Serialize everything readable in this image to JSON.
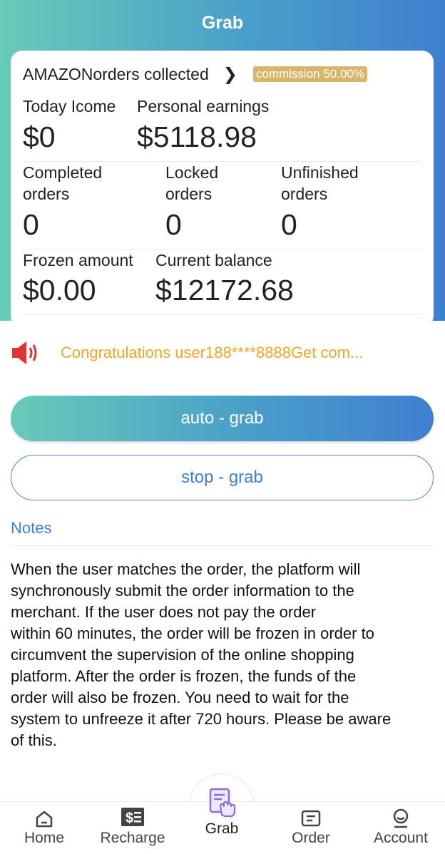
{
  "header": {
    "title": "Grab"
  },
  "card": {
    "title": "AMAZONorders collected",
    "commission_badge": "commission 50.00%",
    "today_income_label": "Today Icome",
    "today_income_value": "$0",
    "personal_earnings_label": "Personal earnings",
    "personal_earnings_value": "$5118.98",
    "completed_orders_label_1": "Completed",
    "completed_orders_label_2": "orders",
    "completed_orders_value": "0",
    "locked_orders_label_1": "Locked",
    "locked_orders_label_2": "orders",
    "locked_orders_value": "0",
    "unfinished_orders_label_1": "Unfinished",
    "unfinished_orders_label_2": "orders",
    "unfinished_orders_value": "0",
    "frozen_amount_label": "Frozen amount",
    "frozen_amount_value": "$0.00",
    "current_balance_label": "Current balance",
    "current_balance_value": "$12172.68"
  },
  "marquee": {
    "text": "Congratulations user188****8888Get com..."
  },
  "actions": {
    "auto_grab": "auto - grab",
    "stop_grab": "stop - grab"
  },
  "notes": {
    "title": "Notes",
    "lines": [
      "When the user matches the order, the platform will",
      "synchronously submit the order information to the",
      "merchant.  If the user does not pay the order",
      "within 60  minutes, the order will be frozen in order to",
      "circumvent the supervision of the online shopping",
      "platform.  After the order is frozen, the funds of the",
      "order will also be frozen. You need to wait for the",
      "system to unfreeze it after 720 hours. Please be aware",
      "of this."
    ]
  },
  "tabbar": {
    "items": [
      {
        "label": "Home",
        "icon": "home-icon"
      },
      {
        "label": "Recharge",
        "icon": "recharge-icon"
      },
      {
        "label": "Grab",
        "icon": "grab-icon"
      },
      {
        "label": "Order",
        "icon": "order-icon"
      },
      {
        "label": "Account",
        "icon": "account-icon"
      }
    ]
  },
  "colors": {
    "gradient_start": "#67cbb9",
    "gradient_end": "#3f7fd0",
    "badge": "#d9b56c",
    "marquee_text": "#f5a623",
    "link_blue": "#3e7fd8",
    "speaker_red": "#e03434"
  }
}
